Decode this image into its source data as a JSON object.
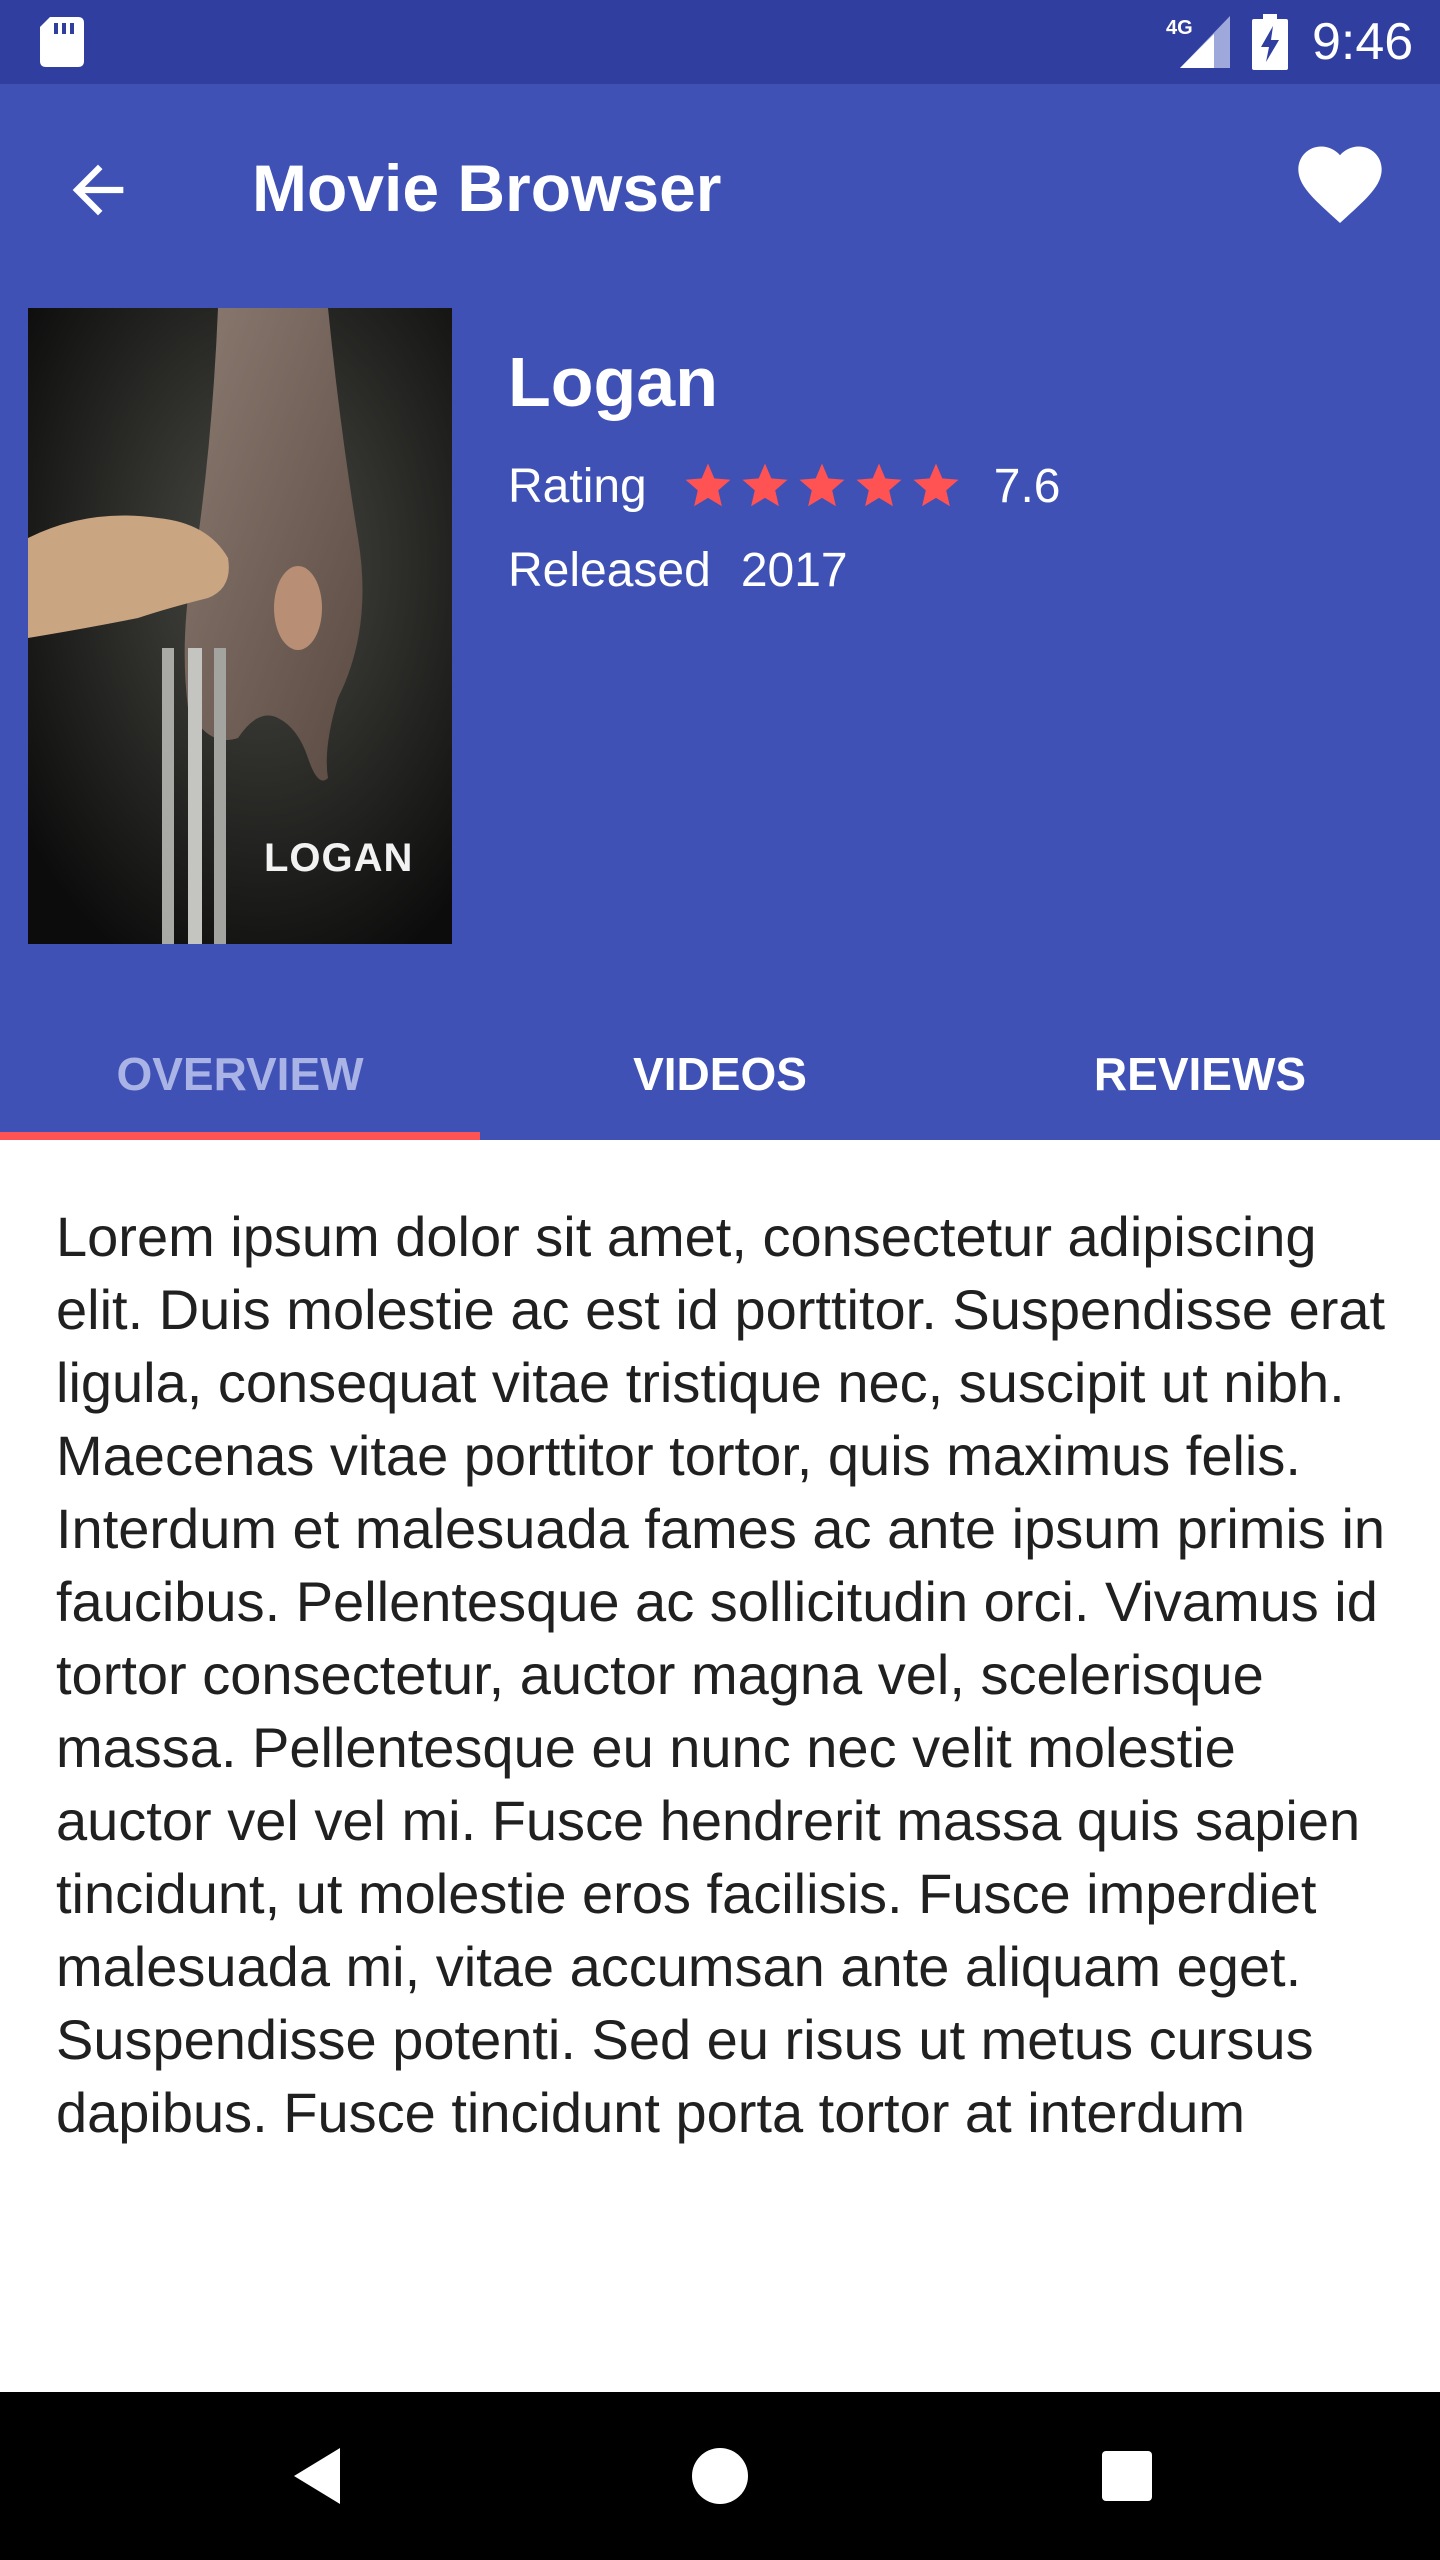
{
  "status_bar": {
    "time": "9:46",
    "network": "4G",
    "icons": [
      "sd-card-icon",
      "signal-icon",
      "battery-charging-icon"
    ]
  },
  "toolbar": {
    "title": "Movie Browser",
    "back_icon": "arrow-back-icon",
    "favorite_icon": "heart-icon"
  },
  "movie": {
    "title": "Logan",
    "poster_text": "LOGAN",
    "rating_label": "Rating",
    "rating_stars": 5,
    "rating_value": "7.6",
    "release_label": "Released",
    "release_year": "2017"
  },
  "tabs": [
    {
      "label": "OVERVIEW",
      "active": true
    },
    {
      "label": "VIDEOS",
      "active": false
    },
    {
      "label": "REVIEWS",
      "active": false
    }
  ],
  "overview": {
    "text": "Lorem ipsum dolor sit amet, consectetur adipiscing elit. Duis molestie ac est id porttitor. Suspendisse erat ligula, consequat vitae tristique nec, suscipit ut nibh. Maecenas vitae porttitor tortor, quis maximus felis. Interdum et malesuada fames ac ante ipsum primis in faucibus. Pellentesque ac sollicitudin orci. Vivamus id tortor consectetur, auctor magna vel, scelerisque massa. Pellentesque eu nunc nec velit molestie auctor vel vel mi. Fusce hendrerit massa quis sapien tincidunt, ut molestie eros facilisis. Fusce imperdiet malesuada mi, vitae accumsan ante aliquam eget. Suspendisse potenti. Sed eu risus ut metus cursus dapibus. Fusce tincidunt porta tortor at interdum"
  },
  "nav_bar": {
    "icons": [
      "nav-back-icon",
      "nav-home-icon",
      "nav-recents-icon"
    ]
  },
  "colors": {
    "primary": "#3f51b5",
    "primary_dark": "#303f9f",
    "accent": "#ff5252",
    "inactive_tab": "#a9b3e6"
  }
}
